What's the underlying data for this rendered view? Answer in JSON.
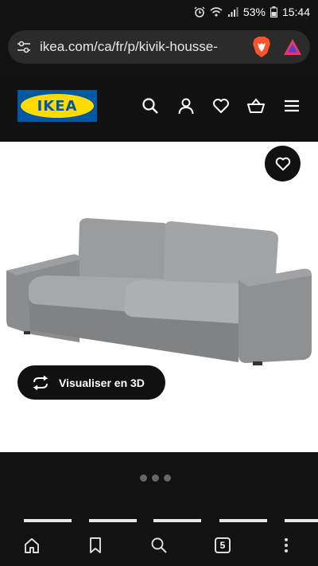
{
  "status": {
    "battery": "53%",
    "time": "15:44"
  },
  "browser": {
    "url": "ikea.com/ca/fr/p/kivik-housse-"
  },
  "header": {
    "logo_text": "IKEA"
  },
  "product": {
    "view3d_label": "Visualiser en 3D",
    "carousel_dots": 3
  },
  "bottom_nav": {
    "tab_count": "5"
  },
  "colors": {
    "brand_blue": "#0058a3",
    "brand_yellow": "#ffdb00",
    "sofa_grey": "#8d8f91"
  }
}
